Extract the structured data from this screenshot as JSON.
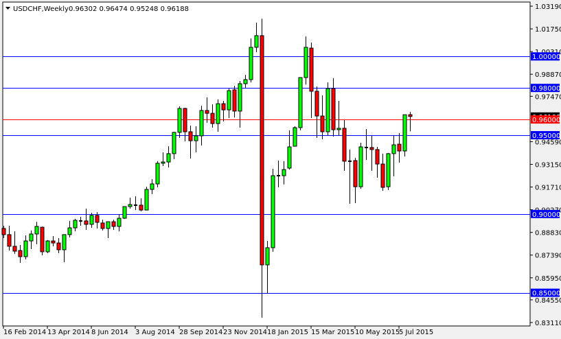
{
  "header": {
    "menu_icon": "triangle-down-icon",
    "symbol_timeframe": "USDCHF,Weekly",
    "ohlc_text": "0.96302 0.96474 0.95248 0.96188"
  },
  "colors": {
    "bull": "#00ff00",
    "bear": "#ff0000",
    "support_line": "#0000ff",
    "pivot_line": "#ff0000",
    "current_price_label": "#000000"
  },
  "chart_data": {
    "type": "candlestick",
    "title": "USDCHF,Weekly",
    "ylim": [
      0.8311,
      1.0319
    ],
    "y_ticks": [
      "1.03190",
      "1.01750",
      "1.00310",
      "0.98870",
      "0.97470",
      "0.94590",
      "0.93150",
      "0.91710",
      "0.90270",
      "0.88830",
      "0.87390",
      "0.85950",
      "0.84550",
      "0.83110"
    ],
    "x_ticks": [
      {
        "index": 0,
        "label": "16 Feb 2014"
      },
      {
        "index": 8,
        "label": "13 Apr 2014"
      },
      {
        "index": 16,
        "label": "8 Jun 2014"
      },
      {
        "index": 24,
        "label": "3 Aug 2014"
      },
      {
        "index": 32,
        "label": "28 Sep 2014"
      },
      {
        "index": 40,
        "label": "23 Nov 2014"
      },
      {
        "index": 48,
        "label": "18 Jan 2015"
      },
      {
        "index": 56,
        "label": "15 Mar 2015"
      },
      {
        "index": 64,
        "label": "10 May 2015"
      },
      {
        "index": 72,
        "label": "5 Jul 2015"
      }
    ],
    "horizontal_lines": [
      {
        "price": 1.0,
        "label": "1.00000",
        "color": "#0000ff"
      },
      {
        "price": 0.98,
        "label": "0.98000",
        "color": "#0000ff"
      },
      {
        "price": 0.96,
        "label": "0.96000",
        "color": "#ff0000"
      },
      {
        "price": 0.95,
        "label": "0.95000",
        "color": "#0000ff"
      },
      {
        "price": 0.9,
        "label": "0.90000",
        "color": "#0000ff"
      },
      {
        "price": 0.85,
        "label": "0.85000",
        "color": "#0000ff"
      }
    ],
    "current_price": {
      "price": 0.96188,
      "label": "0.96188"
    },
    "ohlc": [
      [
        0.8908,
        0.8925,
        0.8847,
        0.8869
      ],
      [
        0.8869,
        0.8925,
        0.8768,
        0.8795
      ],
      [
        0.8795,
        0.889,
        0.8747,
        0.8764
      ],
      [
        0.8768,
        0.8803,
        0.869,
        0.8729
      ],
      [
        0.8729,
        0.8864,
        0.8712,
        0.8829
      ],
      [
        0.8829,
        0.8895,
        0.8777,
        0.8873
      ],
      [
        0.8873,
        0.8951,
        0.8808,
        0.8921
      ],
      [
        0.8916,
        0.8921,
        0.8738,
        0.876
      ],
      [
        0.876,
        0.8834,
        0.8751,
        0.8829
      ],
      [
        0.8829,
        0.886,
        0.8795,
        0.8816
      ],
      [
        0.8816,
        0.8847,
        0.8751,
        0.8773
      ],
      [
        0.8773,
        0.8869,
        0.8694,
        0.8869
      ],
      [
        0.8869,
        0.8956,
        0.8851,
        0.8912
      ],
      [
        0.8912,
        0.8969,
        0.889,
        0.896
      ],
      [
        0.8956,
        0.8982,
        0.8925,
        0.8956
      ],
      [
        0.8956,
        0.9034,
        0.8899,
        0.8934
      ],
      [
        0.8934,
        0.9008,
        0.8912,
        0.8991
      ],
      [
        0.8991,
        0.9012,
        0.8908,
        0.8947
      ],
      [
        0.8943,
        0.8964,
        0.8895,
        0.8908
      ],
      [
        0.8908,
        0.8951,
        0.8847,
        0.8951
      ],
      [
        0.8951,
        0.8964,
        0.8899,
        0.8921
      ],
      [
        0.8921,
        0.8999,
        0.889,
        0.8973
      ],
      [
        0.8973,
        0.9047,
        0.8969,
        0.9047
      ],
      [
        0.9047,
        0.9104,
        0.9034,
        0.906
      ],
      [
        0.9056,
        0.9112,
        0.9025,
        0.9056
      ],
      [
        0.9056,
        0.9099,
        0.9017,
        0.9025
      ],
      [
        0.9025,
        0.9173,
        0.9025,
        0.9156
      ],
      [
        0.9156,
        0.9221,
        0.9126,
        0.9191
      ],
      [
        0.9191,
        0.9335,
        0.9169,
        0.9322
      ],
      [
        0.9322,
        0.9391,
        0.9304,
        0.933
      ],
      [
        0.933,
        0.943,
        0.9295,
        0.9383
      ],
      [
        0.9383,
        0.9522,
        0.9348,
        0.9518
      ],
      [
        0.9518,
        0.9683,
        0.9483,
        0.967
      ],
      [
        0.967,
        0.9674,
        0.9461,
        0.9522
      ],
      [
        0.9522,
        0.9561,
        0.9352,
        0.9465
      ],
      [
        0.9465,
        0.9557,
        0.9391,
        0.9496
      ],
      [
        0.9496,
        0.9687,
        0.9435,
        0.9657
      ],
      [
        0.9657,
        0.974,
        0.9579,
        0.9639
      ],
      [
        0.9639,
        0.9696,
        0.9548,
        0.9574
      ],
      [
        0.9574,
        0.9727,
        0.9522,
        0.97
      ],
      [
        0.97,
        0.9718,
        0.9587,
        0.9661
      ],
      [
        0.9661,
        0.9796,
        0.9609,
        0.9783
      ],
      [
        0.9788,
        0.9814,
        0.9613,
        0.9653
      ],
      [
        0.9653,
        0.9844,
        0.9548,
        0.9827
      ],
      [
        0.9827,
        0.9883,
        0.9801,
        0.9853
      ],
      [
        0.9853,
        1.0114,
        0.9835,
        1.0058
      ],
      [
        1.0058,
        1.0214,
        1.0027,
        1.0132
      ],
      [
        1.0132,
        1.024,
        0.8342,
        0.8677
      ],
      [
        0.8677,
        0.8829,
        0.8494,
        0.8786
      ],
      [
        0.8786,
        0.9287,
        0.876,
        0.9243
      ],
      [
        0.9243,
        0.9339,
        0.9169,
        0.9243
      ],
      [
        0.9243,
        0.9335,
        0.9187,
        0.9282
      ],
      [
        0.9291,
        0.9531,
        0.9282,
        0.9426
      ],
      [
        0.943,
        0.9557,
        0.943,
        0.9548
      ],
      [
        0.9548,
        0.9866,
        0.9531,
        0.9866
      ],
      [
        0.9866,
        1.0127,
        0.9822,
        1.0058
      ],
      [
        1.0053,
        1.0088,
        0.9609,
        0.9779
      ],
      [
        0.9779,
        0.9809,
        0.9483,
        0.9622
      ],
      [
        0.9622,
        0.9753,
        0.9474,
        0.9522
      ],
      [
        0.9522,
        0.9835,
        0.9496,
        0.9796
      ],
      [
        0.9796,
        0.9862,
        0.9491,
        0.9535
      ],
      [
        0.9535,
        0.9718,
        0.9496,
        0.9544
      ],
      [
        0.9544,
        0.9596,
        0.9274,
        0.9335
      ],
      [
        0.9335,
        0.9409,
        0.9065,
        0.9335
      ],
      [
        0.9339,
        0.9356,
        0.9069,
        0.9173
      ],
      [
        0.9173,
        0.9452,
        0.916,
        0.9426
      ],
      [
        0.9422,
        0.9539,
        0.9343,
        0.9422
      ],
      [
        0.9422,
        0.9496,
        0.9274,
        0.9409
      ],
      [
        0.9409,
        0.9426,
        0.923,
        0.9317
      ],
      [
        0.9317,
        0.9383,
        0.9147,
        0.9169
      ],
      [
        0.9173,
        0.9387,
        0.9152,
        0.9383
      ],
      [
        0.9383,
        0.95,
        0.9239,
        0.9439
      ],
      [
        0.9443,
        0.9513,
        0.9326,
        0.94
      ],
      [
        0.94,
        0.9631,
        0.9365,
        0.963
      ],
      [
        0.96302,
        0.96474,
        0.95248,
        0.96188
      ]
    ]
  }
}
